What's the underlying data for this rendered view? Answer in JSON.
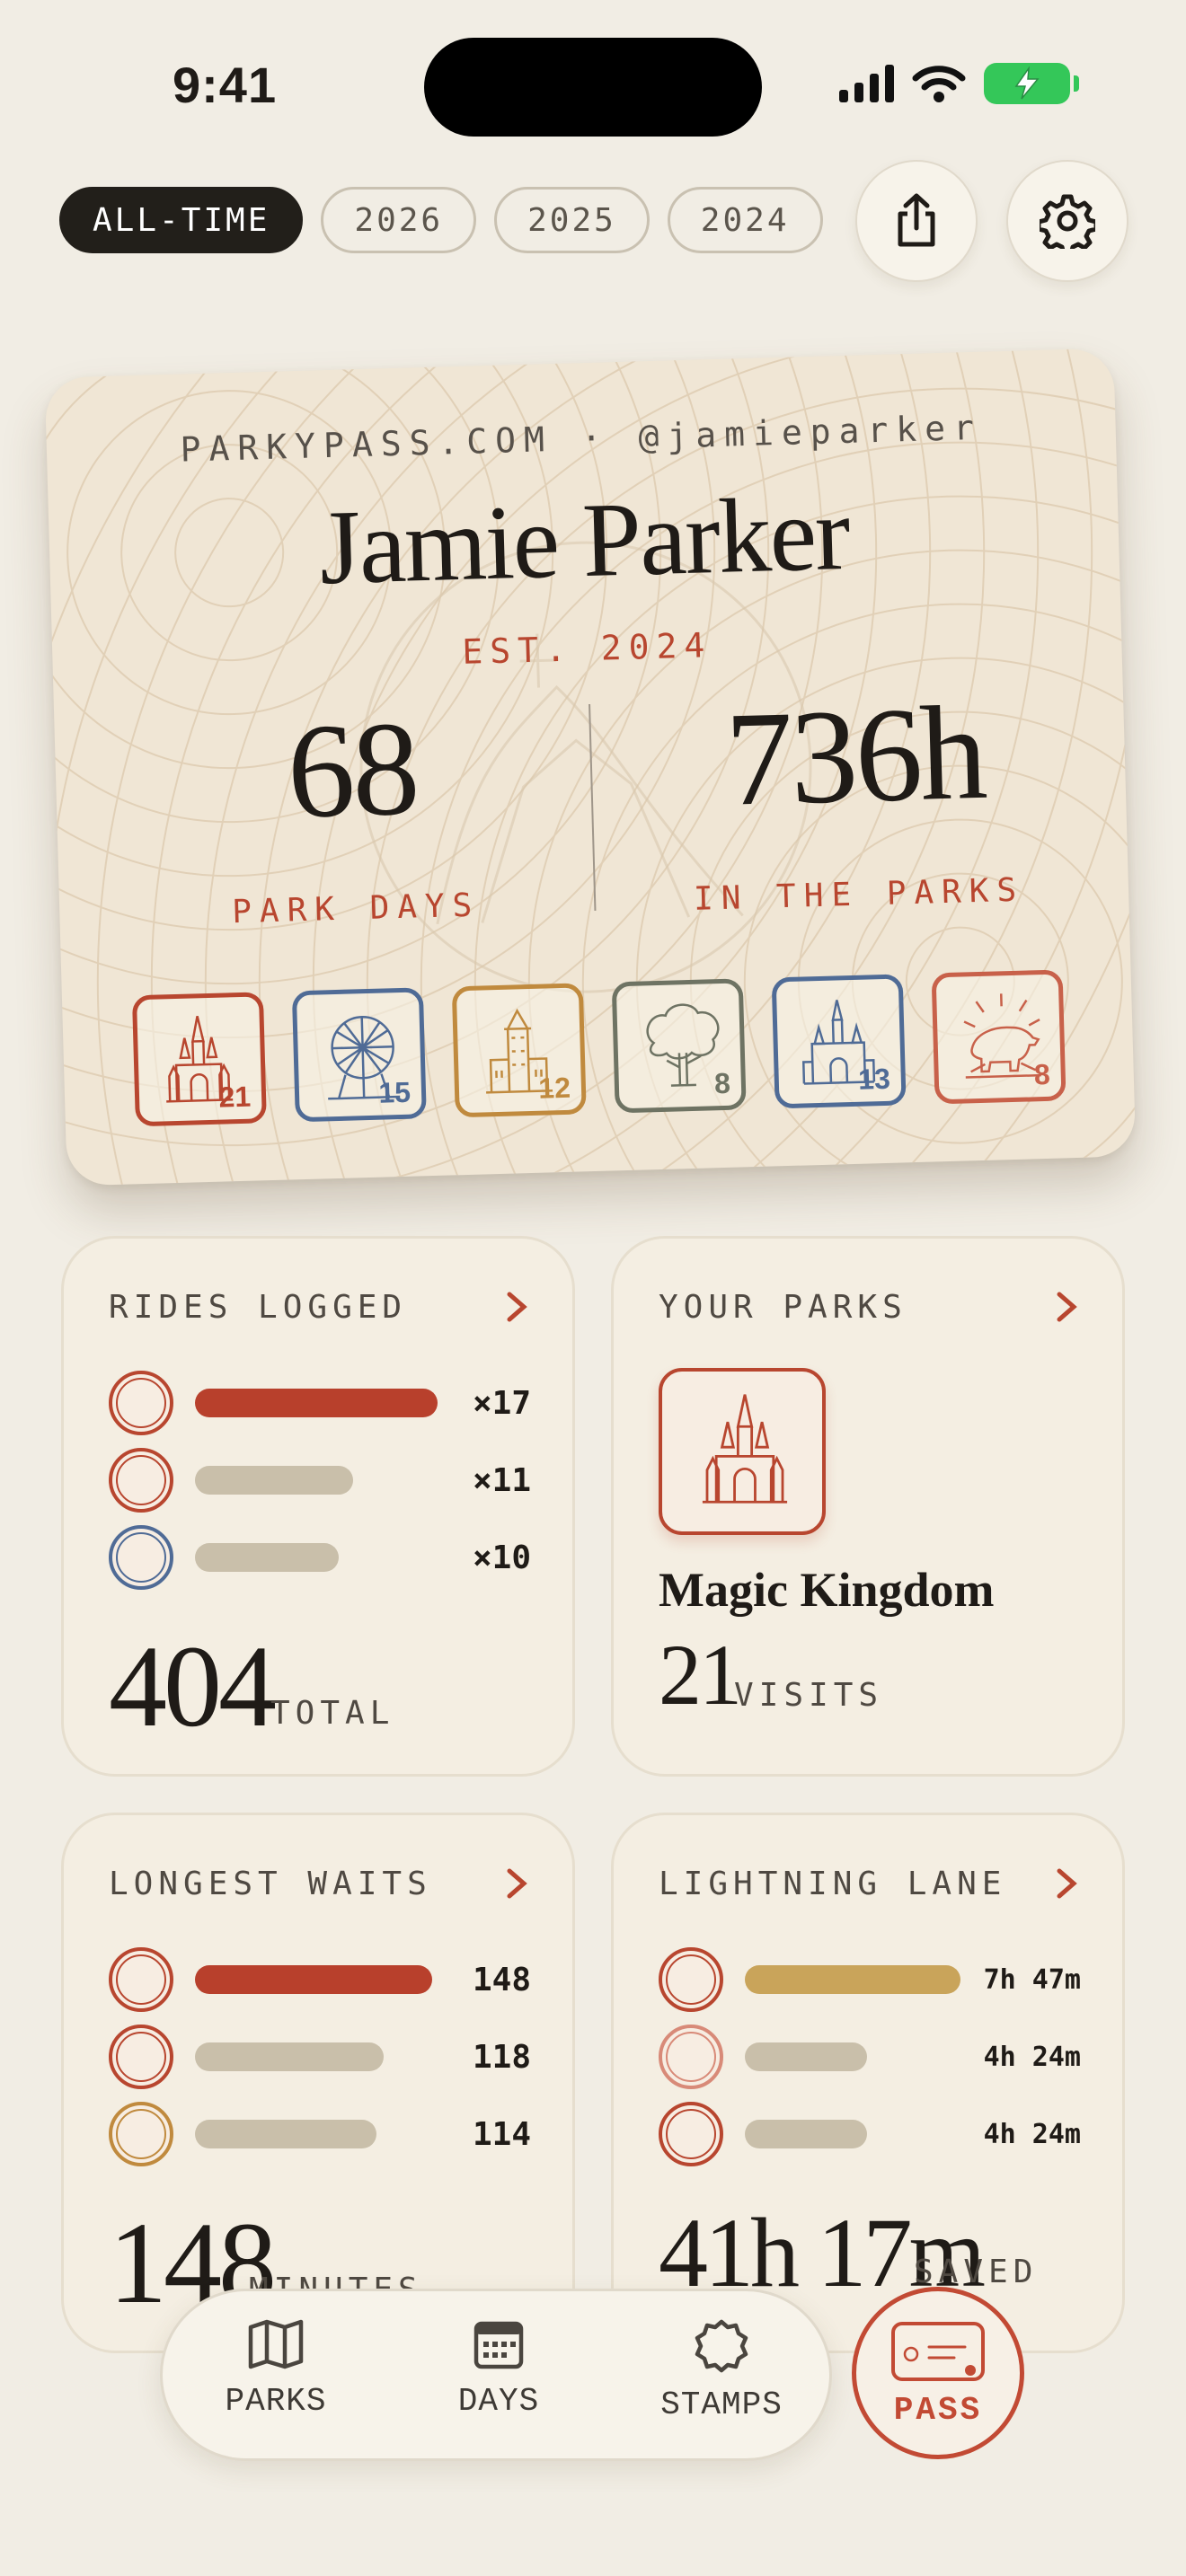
{
  "status": {
    "time": "9:41"
  },
  "filters": [
    {
      "label": "ALL-TIME",
      "active": true
    },
    {
      "label": "2026"
    },
    {
      "label": "2025"
    },
    {
      "label": "2024"
    }
  ],
  "icons": {
    "share": "share-icon",
    "settings": "gear-icon"
  },
  "pass": {
    "site_line": "PARKYPASS.COM · @jamieparker",
    "name": "Jamie Parker",
    "est": "EST. 2024",
    "park_days": "68",
    "park_days_label": "PARK DAYS",
    "hours": "736h",
    "hours_label": "IN THE PARKS",
    "stamps": [
      {
        "icon": "castle-icon",
        "count": "21",
        "color": "#b8462f"
      },
      {
        "icon": "geosphere-icon",
        "count": "15",
        "color": "#4f6b96"
      },
      {
        "icon": "tower-icon",
        "count": "12",
        "color": "#c08a3e"
      },
      {
        "icon": "tree-icon",
        "count": "8",
        "color": "#6e7363"
      },
      {
        "icon": "castle-blue-icon",
        "count": "13",
        "color": "#4f6b96"
      },
      {
        "icon": "bear-icon",
        "count": "8",
        "color": "#c8614a"
      }
    ]
  },
  "rides": {
    "title": "RIDES LOGGED",
    "rows": [
      {
        "value": "×17",
        "fill": 1.0
      },
      {
        "value": "×11",
        "fill": 0.65
      },
      {
        "value": "×10",
        "fill": 0.59
      }
    ],
    "total": "404",
    "total_label": "TOTAL"
  },
  "parks": {
    "title": "YOUR PARKS",
    "park_name": "Magic Kingdom",
    "visits": "21",
    "visits_label": "VISITS"
  },
  "waits": {
    "title": "LONGEST WAITS",
    "rows": [
      {
        "value": "148",
        "fill": 1.0
      },
      {
        "value": "118",
        "fill": 0.8
      },
      {
        "value": "114",
        "fill": 0.77
      }
    ],
    "total": "148",
    "total_label": "MINUTES"
  },
  "lightning": {
    "title": "LIGHTNING LANE",
    "rows": [
      {
        "value": "7h 47m",
        "fill": 1.0
      },
      {
        "value": "4h 24m",
        "fill": 0.57
      },
      {
        "value": "4h 24m",
        "fill": 0.57
      }
    ],
    "total": "41h 17m",
    "total_label": "SAVED"
  },
  "nav": {
    "parks": "PARKS",
    "days": "DAYS",
    "stamps": "STAMPS",
    "pass": "PASS"
  },
  "colors": {
    "accent": "#b8462f",
    "bar_muted": "#c9bfaa",
    "bar_gold": "#c9a45a",
    "background": "#f1ede4"
  }
}
